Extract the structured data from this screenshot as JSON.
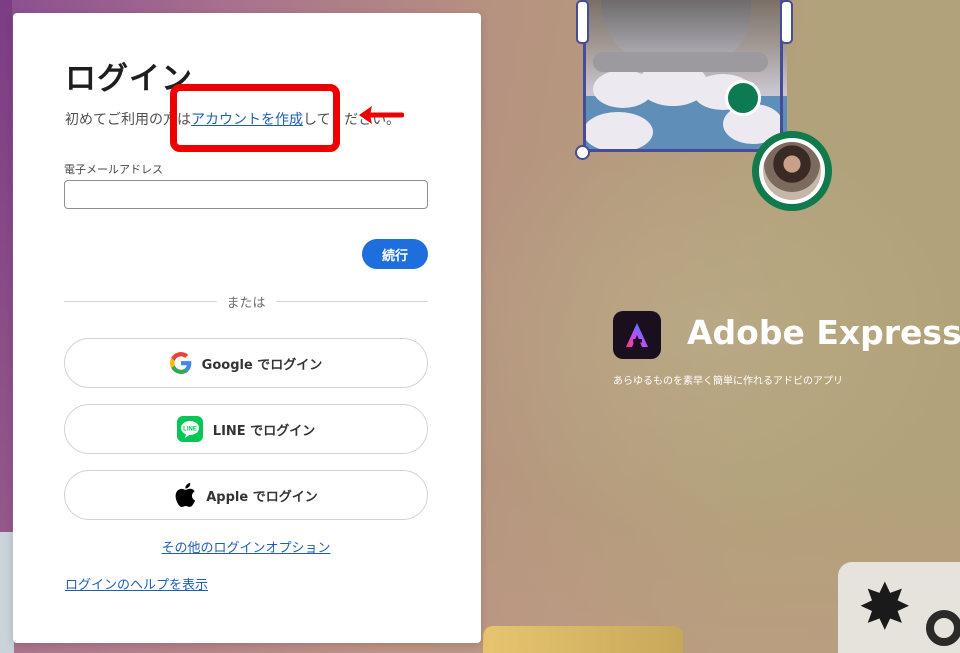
{
  "login": {
    "title": "ログイン",
    "subtitle_prefix": "初めてご利用の方は",
    "create_account_link": "アカウントを作成",
    "subtitle_suffix": "してください。",
    "email_label": "電子メールアドレス",
    "email_value": "",
    "continue_label": "続行",
    "divider_text": "または",
    "google_label": "Google でログイン",
    "line_label": "LINE でログイン",
    "apple_label": "Apple でログイン",
    "other_options_link": "その他のログインオプション",
    "help_link": "ログインのヘルプを表示"
  },
  "brand": {
    "name": "Adobe Express",
    "tagline": "あらゆるものを素早く簡単に作れるアドビのアプリ"
  },
  "icons": {
    "google": "google-icon",
    "line": "line-icon",
    "apple": "apple-icon",
    "adobe_express": "adobe-express-logo-icon"
  },
  "colors": {
    "accent_blue": "#1f6ede",
    "link_blue": "#1f5fb7",
    "annotation_red": "#ee0000",
    "line_green": "#06c755"
  }
}
